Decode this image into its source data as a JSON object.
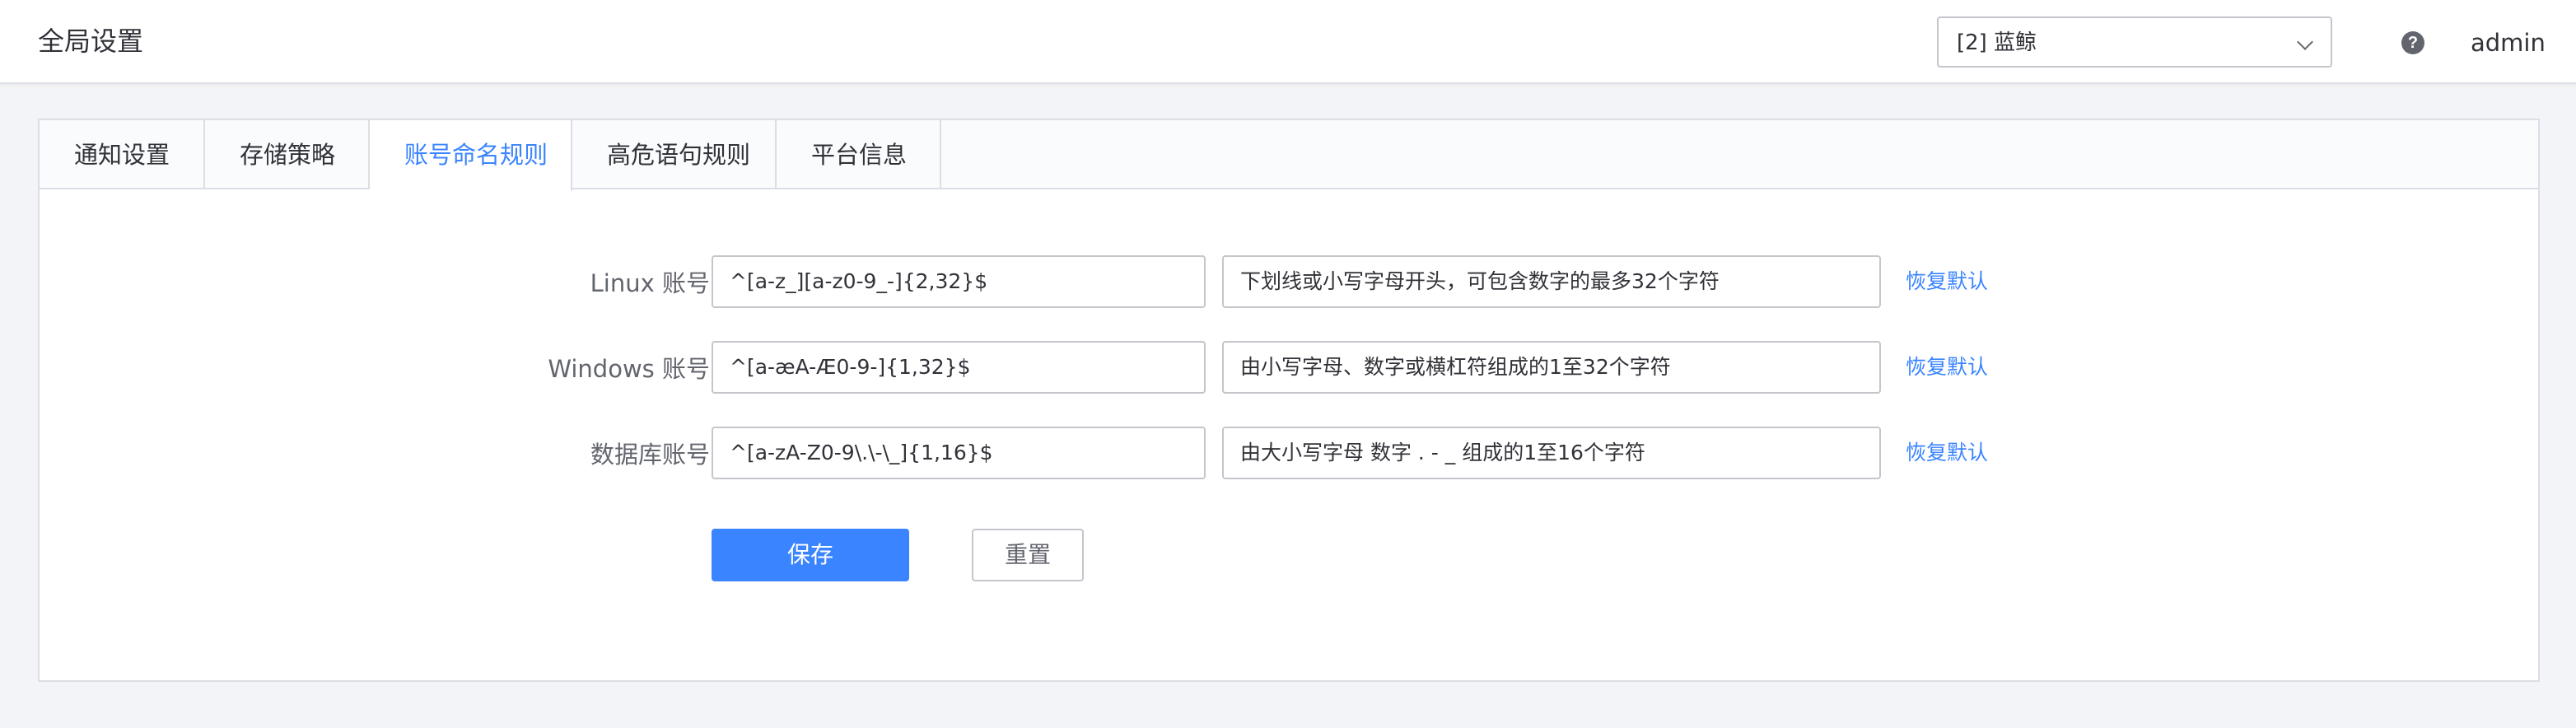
{
  "header": {
    "title": "全局设置",
    "business_select_value": "[2] 蓝鲸",
    "help_icon": "?",
    "user": "admin"
  },
  "tabs": [
    {
      "label": "通知设置",
      "active": false
    },
    {
      "label": "存储策略",
      "active": false
    },
    {
      "label": "账号命名规则",
      "active": true
    },
    {
      "label": "高危语句规则",
      "active": false
    },
    {
      "label": "平台信息",
      "active": false
    }
  ],
  "rules": [
    {
      "label": "Linux 账号",
      "rule": "^[a-z_][a-z0-9_-]{2,32}$",
      "description": "下划线或小写字母开头，可包含数字的最多32个字符",
      "restore": "恢复默认"
    },
    {
      "label": "Windows 账号",
      "rule": "^[a-æA-Æ0-9-]{1,32}$",
      "description": "由小写字母、数字或横杠符组成的1至32个字符",
      "restore": "恢复默认"
    },
    {
      "label": "数据库账号",
      "rule": "^[a-zA-Z0-9\\.\\-\\_]{1,16}$",
      "description": "由大小写字母 数字 . - _ 组成的1至16个字符",
      "restore": "恢复默认"
    }
  ],
  "actions": {
    "save": "保存",
    "reset": "重置"
  },
  "colors": {
    "accent": "#3a84ff",
    "border": "#c4c6cc",
    "background": "#f3f4f7"
  }
}
